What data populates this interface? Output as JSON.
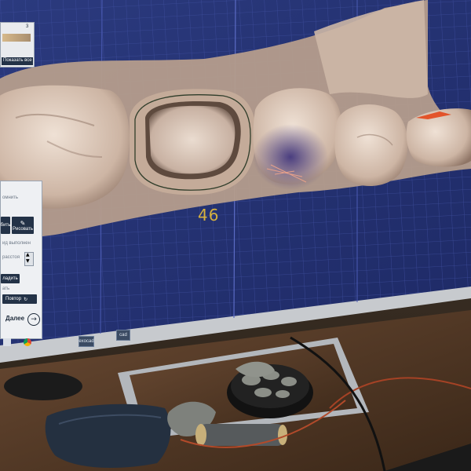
{
  "viewer": {
    "tooth_number": "46"
  },
  "top_left_panel": {
    "show_all_label": "Показать все",
    "badge_top": "3"
  },
  "left_toolbar": {
    "partial_label_1": "омнить",
    "button_1_label": "бить",
    "button_2_label": "Рисовать",
    "partial_label_2": "ид выполнен",
    "partial_label_3": "расстоя",
    "apply_label": "ладить",
    "partial_label_4": "ать",
    "repeat_label": "Повтор",
    "next_label": "Далее"
  },
  "taskbar": {
    "items": [
      "exocad",
      "cad"
    ]
  },
  "colors": {
    "screen_bg": "#23306e",
    "grid": "#3b4a92",
    "model": "#d9c4b5",
    "bezel": "#c9ccd0",
    "desk": "#5b3e29",
    "wall": "#3a2e25",
    "tooth_label": "#d6b13e",
    "panel_dark": "#233247"
  },
  "icons": [
    "checkbox-icon",
    "draw-pen-icon",
    "arrow-right-circle-icon",
    "spinner-up-icon",
    "spinner-down-icon",
    "chrome-icon",
    "windows-start-icon"
  ]
}
